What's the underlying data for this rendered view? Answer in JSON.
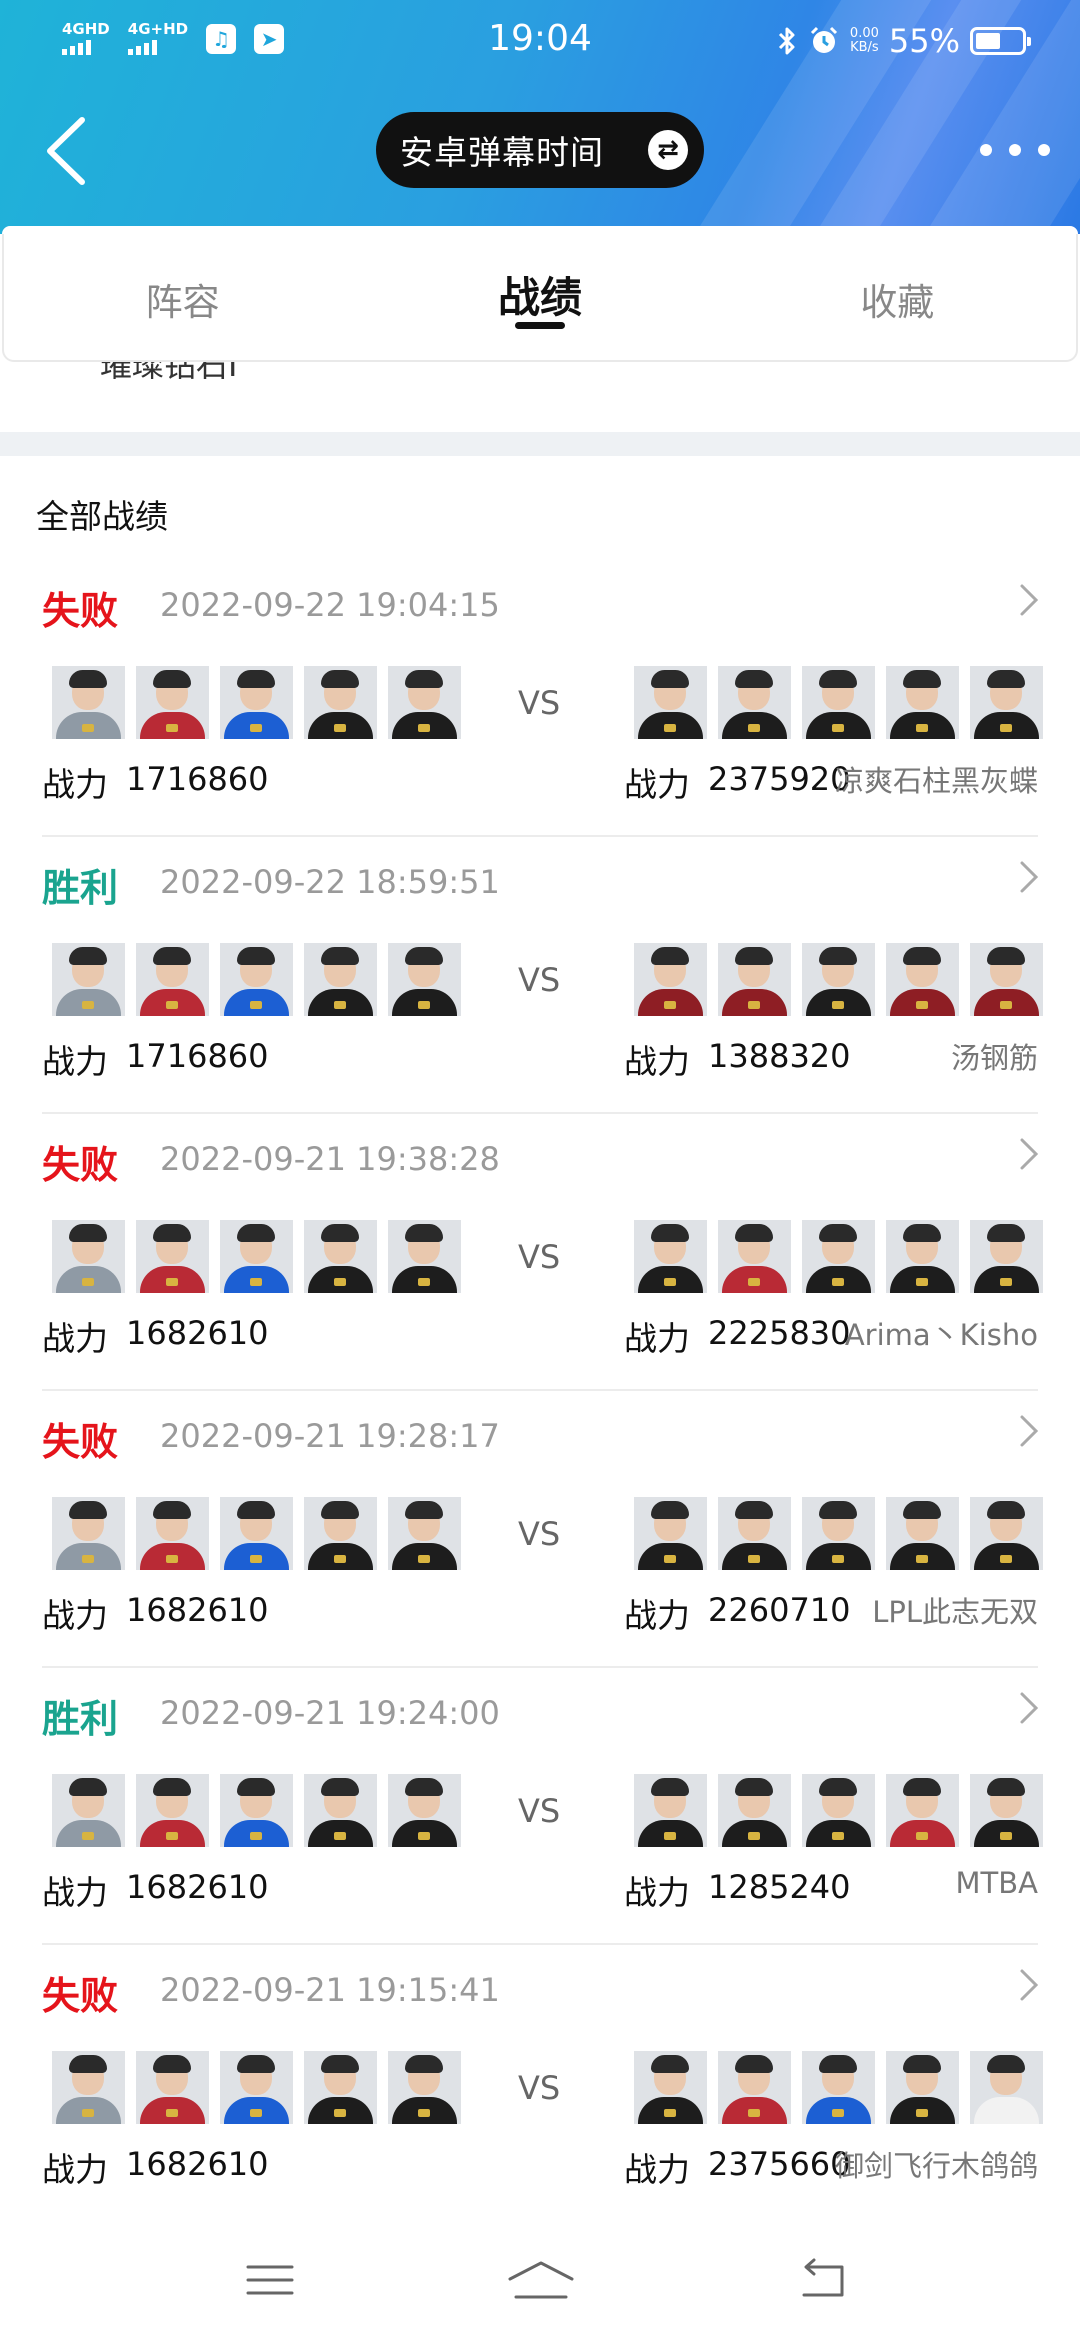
{
  "status_bar": {
    "time": "19:04",
    "net1": "4GHD",
    "net2": "4G+HD",
    "speed_value": "0.00",
    "speed_unit": "KB/s",
    "battery_percent": "55%",
    "battery_level": 0.55,
    "icons": [
      "music-icon",
      "telegram-icon",
      "bluetooth-icon",
      "alarm-icon"
    ]
  },
  "header": {
    "title": "安卓弹幕时间",
    "swap_icon": "⇄"
  },
  "tabs": [
    {
      "label": "阵容",
      "active": false
    },
    {
      "label": "战绩",
      "active": true
    },
    {
      "label": "收藏",
      "active": false
    }
  ],
  "peek_text": "璀璨钻石I",
  "section_title": "全部战绩",
  "power_label": "战力",
  "vs_label": "VS",
  "records": [
    {
      "result": "失败",
      "result_type": "loss",
      "time": "2022-09-22 19:04:15",
      "my_power": "1716860",
      "opp_power": "2375920",
      "opp_name": "凉爽石柱黑灰蝶",
      "my_jerseys": [
        "#8f9aa5",
        "#b92a35",
        "#1c5fd3",
        "#1d1d1d",
        "#1d1d1d"
      ],
      "opp_jerseys": [
        "#1d1d1d",
        "#1d1d1d",
        "#1d1d1d",
        "#1d1d1d",
        "#1d1d1d"
      ]
    },
    {
      "result": "胜利",
      "result_type": "win",
      "time": "2022-09-22 18:59:51",
      "my_power": "1716860",
      "opp_power": "1388320",
      "opp_name": "汤钢筋",
      "my_jerseys": [
        "#8f9aa5",
        "#b92a35",
        "#1c5fd3",
        "#1d1d1d",
        "#1d1d1d"
      ],
      "opp_jerseys": [
        "#8e1e24",
        "#8e1e24",
        "#1d1d1d",
        "#8e1e24",
        "#8e1e24"
      ]
    },
    {
      "result": "失败",
      "result_type": "loss",
      "time": "2022-09-21 19:38:28",
      "my_power": "1682610",
      "opp_power": "2225830",
      "opp_name": "Arima丶Kisho",
      "my_jerseys": [
        "#8f9aa5",
        "#b92a35",
        "#1c5fd3",
        "#1d1d1d",
        "#1d1d1d"
      ],
      "opp_jerseys": [
        "#1d1d1d",
        "#b92a35",
        "#1d1d1d",
        "#1d1d1d",
        "#1d1d1d"
      ]
    },
    {
      "result": "失败",
      "result_type": "loss",
      "time": "2022-09-21 19:28:17",
      "my_power": "1682610",
      "opp_power": "2260710",
      "opp_name": "LPL此志无双",
      "my_jerseys": [
        "#8f9aa5",
        "#b92a35",
        "#1c5fd3",
        "#1d1d1d",
        "#1d1d1d"
      ],
      "opp_jerseys": [
        "#1d1d1d",
        "#1d1d1d",
        "#1d1d1d",
        "#1d1d1d",
        "#1d1d1d"
      ]
    },
    {
      "result": "胜利",
      "result_type": "win",
      "time": "2022-09-21 19:24:00",
      "my_power": "1682610",
      "opp_power": "1285240",
      "opp_name": "MTBA",
      "my_jerseys": [
        "#8f9aa5",
        "#b92a35",
        "#1c5fd3",
        "#1d1d1d",
        "#1d1d1d"
      ],
      "opp_jerseys": [
        "#1d1d1d",
        "#1d1d1d",
        "#1d1d1d",
        "#b92a35",
        "#1d1d1d"
      ]
    },
    {
      "result": "失败",
      "result_type": "loss",
      "time": "2022-09-21 19:15:41",
      "my_power": "1682610",
      "opp_power": "2375660",
      "opp_name": "御剑飞行木鸽鸽",
      "my_jerseys": [
        "#8f9aa5",
        "#b92a35",
        "#1c5fd3",
        "#1d1d1d",
        "#1d1d1d"
      ],
      "opp_jerseys": [
        "#1d1d1d",
        "#b92a35",
        "#1c5fd3",
        "#1d1d1d",
        "#f2f2f2"
      ]
    }
  ],
  "bottom_nav": [
    "menu-icon",
    "home-icon",
    "back-icon"
  ]
}
